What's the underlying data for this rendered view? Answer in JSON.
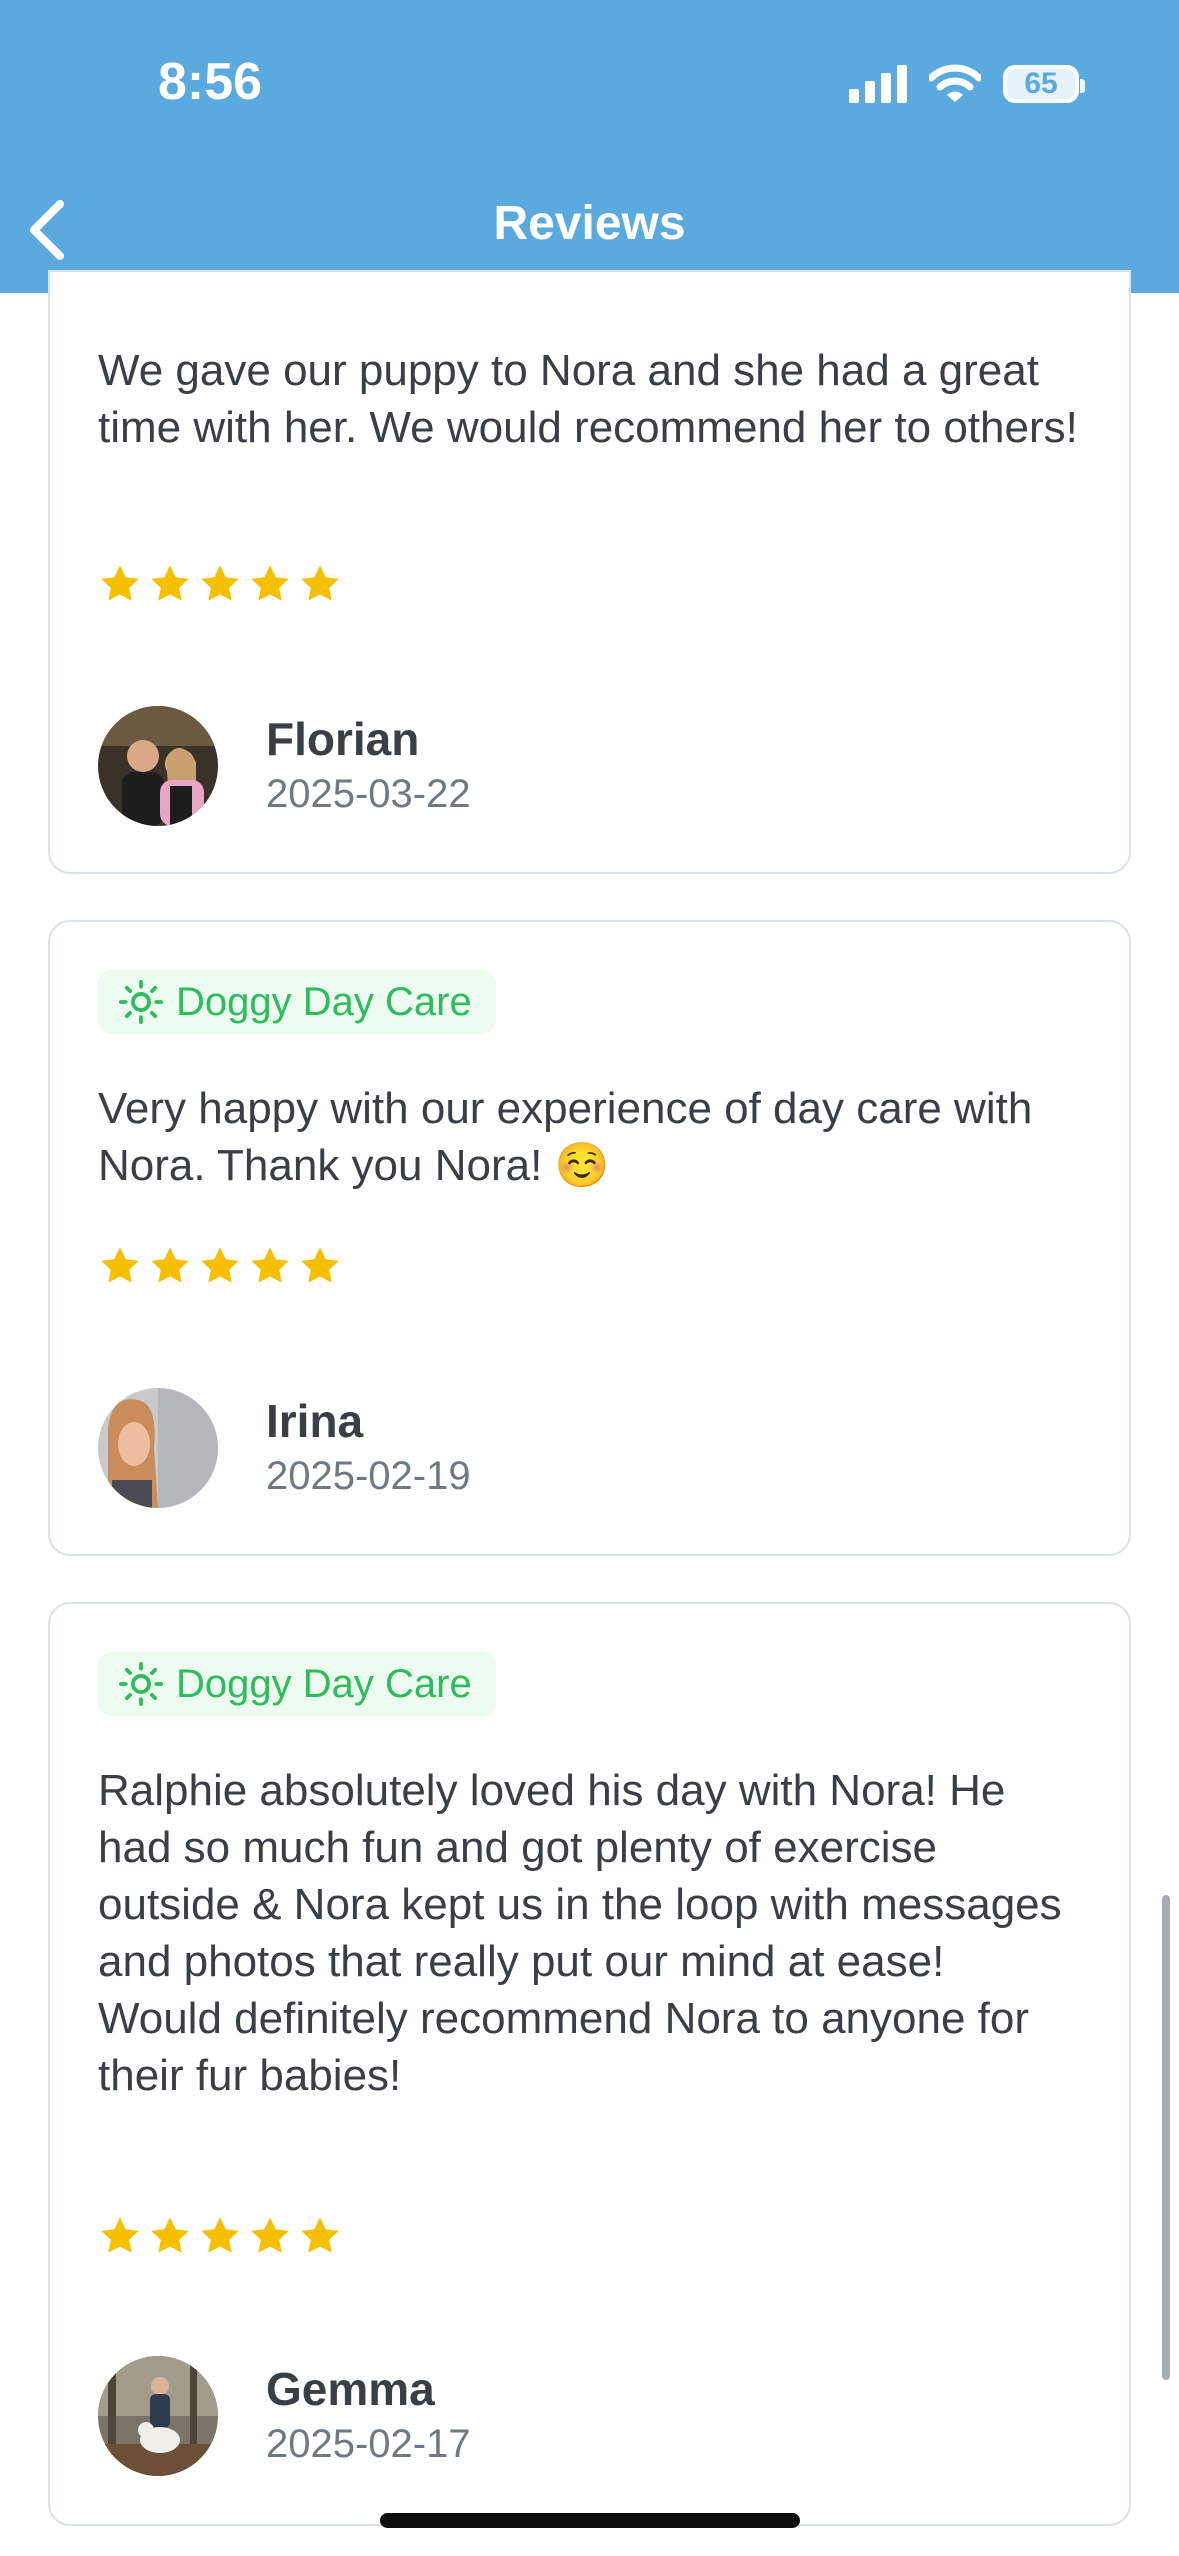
{
  "status_bar": {
    "time": "8:56",
    "battery": "65"
  },
  "header": {
    "title": "Reviews"
  },
  "reviews": [
    {
      "tag": null,
      "text": "We gave our puppy to Nora and she had a great time with her. We would recommend her to others!",
      "rating": 5,
      "name": "Florian",
      "date": "2025-03-22"
    },
    {
      "tag": "Doggy Day Care",
      "text": "Very happy with our experience of day care with Nora. Thank you Nora! ☺️",
      "rating": 5,
      "name": "Irina",
      "date": "2025-02-19"
    },
    {
      "tag": "Doggy Day Care",
      "text": "Ralphie absolutely loved his day with Nora! He had so much fun and got plenty of exercise outside & Nora kept us in the loop with messages and photos that really put our mind at ease!\nWould definitely recommend Nora to anyone for their fur babies!",
      "rating": 5,
      "name": "Gemma",
      "date": "2025-02-17"
    }
  ],
  "colors": {
    "header": "#5aaae0",
    "star": "#f6c000",
    "tag_text": "#2dbd5c",
    "tag_bg": "#eefbf1"
  },
  "icons": {
    "back": "chevron-left-icon",
    "tag": "sun-icon",
    "star": "star-icon"
  }
}
